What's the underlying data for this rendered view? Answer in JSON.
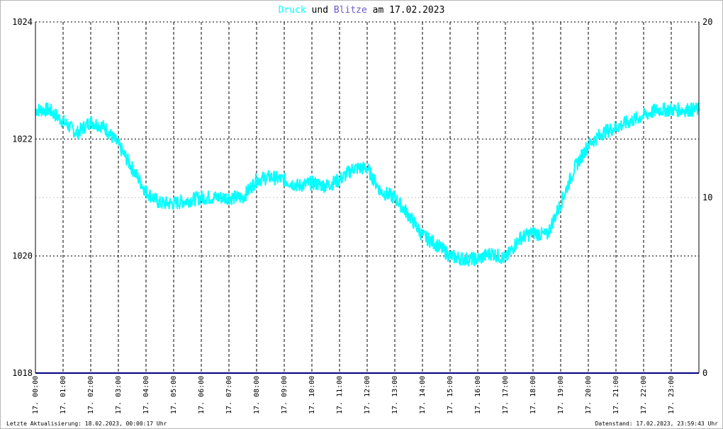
{
  "title": {
    "part1": "Druck",
    "part2": " und ",
    "part3": "Blitze",
    "part4": " am 17.02.2023"
  },
  "colors": {
    "pressure": "#00ffff",
    "lightning": "#6a5acd",
    "baseline": "#000080",
    "grid": "#000000",
    "minor_grid": "#c8c8c8"
  },
  "footer": {
    "left": "Letzte Aktualisierung: 18.02.2023, 00:00:17 Uhr",
    "right": "Datenstand: 17.02.2023, 23:59:43 Uhr"
  },
  "chart_data": {
    "type": "line",
    "title": "Druck und Blitze am 17.02.2023",
    "x_unit": "hours",
    "xlim": [
      0,
      24
    ],
    "x_tick_labels": [
      "17. 00:00",
      "17. 01:00",
      "17. 02:00",
      "17. 03:00",
      "17. 04:00",
      "17. 05:00",
      "17. 06:00",
      "17. 07:00",
      "17. 08:00",
      "17. 09:00",
      "17. 10:00",
      "17. 11:00",
      "17. 12:00",
      "17. 13:00",
      "17. 14:00",
      "17. 15:00",
      "17. 16:00",
      "17. 17:00",
      "17. 18:00",
      "17. 19:00",
      "17. 20:00",
      "17. 21:00",
      "17. 22:00",
      "17. 23:00"
    ],
    "y_left": {
      "ylim": [
        1018,
        1024
      ],
      "ticks": [
        1018,
        1020,
        1022,
        1024
      ]
    },
    "y_right": {
      "ylim": [
        0,
        20
      ],
      "ticks": [
        0,
        10,
        20
      ]
    },
    "grid": true,
    "series": [
      {
        "name": "Druck",
        "axis": "left",
        "x": [
          0,
          0.5,
          1,
          1.5,
          2,
          2.5,
          3,
          3.5,
          4,
          4.5,
          5,
          5.5,
          6,
          6.5,
          7,
          7.5,
          8,
          8.5,
          9,
          9.5,
          10,
          10.5,
          11,
          11.5,
          12,
          12.5,
          13,
          13.5,
          14,
          14.5,
          15,
          15.5,
          16,
          16.5,
          17,
          17.5,
          18,
          18.5,
          19,
          19.5,
          20,
          20.5,
          21,
          21.5,
          22,
          22.5,
          23,
          23.5,
          24
        ],
        "values": [
          1022.5,
          1022.5,
          1022.3,
          1022.1,
          1022.3,
          1022.2,
          1021.9,
          1021.5,
          1021.1,
          1020.9,
          1020.9,
          1020.95,
          1021.0,
          1021.0,
          1021.0,
          1021.0,
          1021.3,
          1021.35,
          1021.3,
          1021.2,
          1021.25,
          1021.2,
          1021.3,
          1021.5,
          1021.5,
          1021.1,
          1021.0,
          1020.7,
          1020.35,
          1020.2,
          1020.0,
          1019.95,
          1019.95,
          1020.05,
          1019.95,
          1020.3,
          1020.4,
          1020.35,
          1020.9,
          1021.5,
          1021.9,
          1022.1,
          1022.2,
          1022.3,
          1022.4,
          1022.5,
          1022.5,
          1022.5,
          1022.5
        ],
        "noise": 0.12
      },
      {
        "name": "Blitze",
        "axis": "right",
        "x": [
          0,
          24
        ],
        "values": [
          0,
          0
        ]
      }
    ]
  }
}
